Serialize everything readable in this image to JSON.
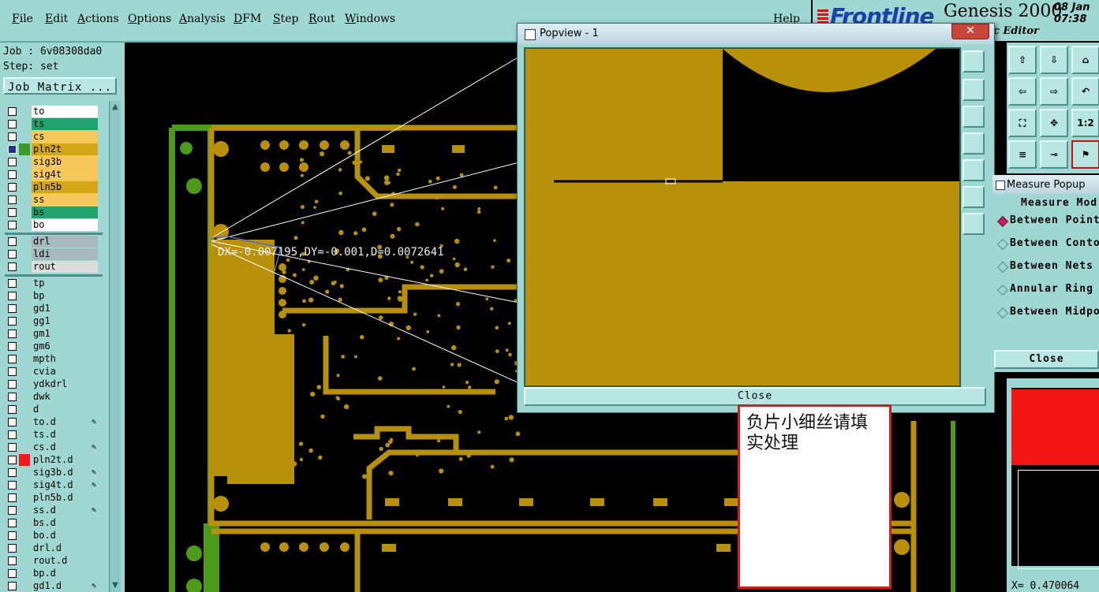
{
  "menu": {
    "items": [
      "File",
      "Edit",
      "Actions",
      "Options",
      "Analysis",
      "DFM",
      "Step",
      "Rout",
      "Windows"
    ],
    "help": "Help"
  },
  "brand": {
    "logo": "Frontline",
    "title": "Genesis 2000",
    "date": "08 Jan",
    "time": "07:38",
    "editor": "ic Editor"
  },
  "job": {
    "job_line": "Job : 6v08308da0",
    "step_line": "Step: set",
    "matrix_button": "Job Matrix ..."
  },
  "layers": {
    "signal": [
      {
        "name": "to",
        "color": "#ffffff",
        "swatch": "#9fd7d3"
      },
      {
        "name": "ts",
        "color": "#20a36f",
        "swatch": "#9fd7d3"
      },
      {
        "name": "cs",
        "color": "#f7c85a",
        "swatch": "#9fd7d3"
      },
      {
        "name": "pln2t",
        "color": "#d4a517",
        "swatch": "#3a9a2c",
        "active": true
      },
      {
        "name": "sig3b",
        "color": "#f7c85a",
        "swatch": "#9fd7d3"
      },
      {
        "name": "sig4t",
        "color": "#f7c85a",
        "swatch": "#9fd7d3"
      },
      {
        "name": "pln5b",
        "color": "#d4a517",
        "swatch": "#9fd7d3"
      },
      {
        "name": "ss",
        "color": "#f7c85a",
        "swatch": "#9fd7d3"
      },
      {
        "name": "bs",
        "color": "#20a36f",
        "swatch": "#9fd7d3"
      },
      {
        "name": "bo",
        "color": "#ffffff",
        "swatch": "#9fd7d3"
      }
    ],
    "drill": [
      {
        "name": "drl",
        "color": "#a8b8bd",
        "swatch": "#9fd7d3"
      },
      {
        "name": "ldi",
        "color": "#a8b8bd",
        "swatch": "#9fd7d3"
      },
      {
        "name": "rout",
        "color": "#dcdcdc",
        "swatch": "#9fd7d3"
      }
    ],
    "misc": [
      {
        "name": "tp",
        "edit": false
      },
      {
        "name": "bp",
        "edit": false
      },
      {
        "name": "gd1",
        "edit": false
      },
      {
        "name": "gg1",
        "edit": false
      },
      {
        "name": "gm1",
        "edit": false
      },
      {
        "name": "gm6",
        "edit": false
      },
      {
        "name": "mpth",
        "edit": false
      },
      {
        "name": "cvia",
        "edit": false
      },
      {
        "name": "ydkdrl",
        "edit": false
      },
      {
        "name": "dwk",
        "edit": false
      },
      {
        "name": "d",
        "edit": false
      },
      {
        "name": "to.d",
        "edit": true
      },
      {
        "name": "ts.d",
        "edit": false
      },
      {
        "name": "cs.d",
        "edit": true
      },
      {
        "name": "pln2t.d",
        "edit": false,
        "swatch": "#f01a1a"
      },
      {
        "name": "sig3b.d",
        "edit": true
      },
      {
        "name": "sig4t.d",
        "edit": true
      },
      {
        "name": "pln5b.d",
        "edit": false
      },
      {
        "name": "ss.d",
        "edit": true
      },
      {
        "name": "bs.d",
        "edit": false
      },
      {
        "name": "bo.d",
        "edit": false
      },
      {
        "name": "drl.d",
        "edit": false
      },
      {
        "name": "rout.d",
        "edit": false
      },
      {
        "name": "bp.d",
        "edit": false
      },
      {
        "name": "gd1.d",
        "edit": true
      }
    ]
  },
  "measurement": {
    "readout": "DX=-0.007195,DY=-0.001,D=0.0072641"
  },
  "popview": {
    "title": "Popview - 1",
    "close_label": "Close",
    "close_x": "✕"
  },
  "measure_popup": {
    "title": "Measure Popup",
    "mode_label": "Measure Mod",
    "options": [
      {
        "label": "Between Point",
        "selected": true
      },
      {
        "label": "Between Conto",
        "selected": false
      },
      {
        "label": "Between Nets",
        "selected": false
      },
      {
        "label": "Annular Ring",
        "selected": false
      },
      {
        "label": "Between Midpo",
        "selected": false
      }
    ],
    "close_label": "Close"
  },
  "right_tools": {
    "scale_label": "1:2"
  },
  "overview": {
    "coord": "X= 0.470064"
  },
  "note": {
    "text": "负片小细丝请填实处理"
  },
  "colors": {
    "panel": "#9fd7d3",
    "copper": "#b8900a",
    "board_outline": "#4c9a1a",
    "highlight": "#f01a1a"
  }
}
